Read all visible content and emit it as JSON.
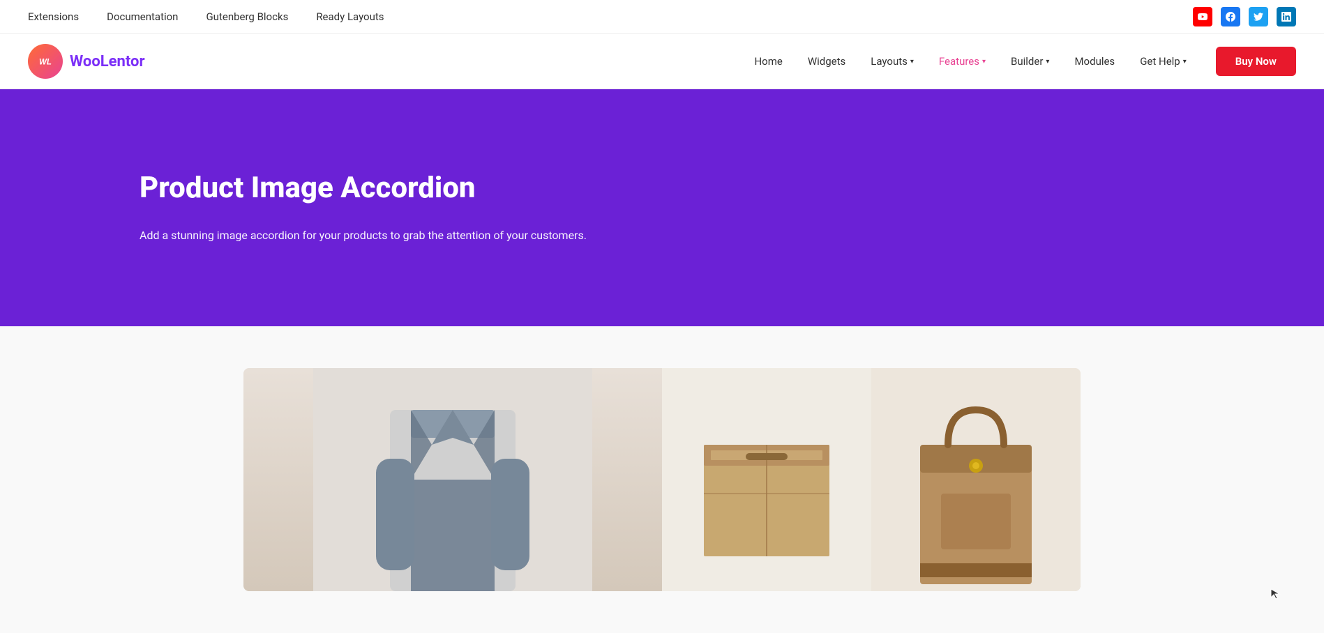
{
  "topbar": {
    "nav": [
      {
        "label": "Extensions",
        "href": "#"
      },
      {
        "label": "Documentation",
        "href": "#"
      },
      {
        "label": "Gutenberg Blocks",
        "href": "#"
      },
      {
        "label": "Ready Layouts",
        "href": "#"
      }
    ],
    "social": [
      {
        "name": "youtube",
        "label": "Y"
      },
      {
        "name": "facebook",
        "label": "f"
      },
      {
        "name": "twitter",
        "label": "t"
      },
      {
        "name": "linkedin",
        "label": "in"
      }
    ]
  },
  "mainnav": {
    "logo": {
      "icon_text": "WL",
      "brand_first": "Woo",
      "brand_second": "Lentor"
    },
    "links": [
      {
        "label": "Home",
        "active": false,
        "has_dropdown": false
      },
      {
        "label": "Widgets",
        "active": false,
        "has_dropdown": false
      },
      {
        "label": "Layouts",
        "active": false,
        "has_dropdown": true
      },
      {
        "label": "Features",
        "active": true,
        "has_dropdown": true
      },
      {
        "label": "Builder",
        "active": false,
        "has_dropdown": true
      },
      {
        "label": "Modules",
        "active": false,
        "has_dropdown": false
      },
      {
        "label": "Get Help",
        "active": false,
        "has_dropdown": true
      }
    ],
    "cta_label": "Buy Now"
  },
  "hero": {
    "title": "Product Image Accordion",
    "description": "Add a stunning image accordion for your products to grab the attention of your customers.",
    "bg_color": "#6b21d6"
  },
  "content": {
    "bg_color": "#f9f9f9"
  }
}
